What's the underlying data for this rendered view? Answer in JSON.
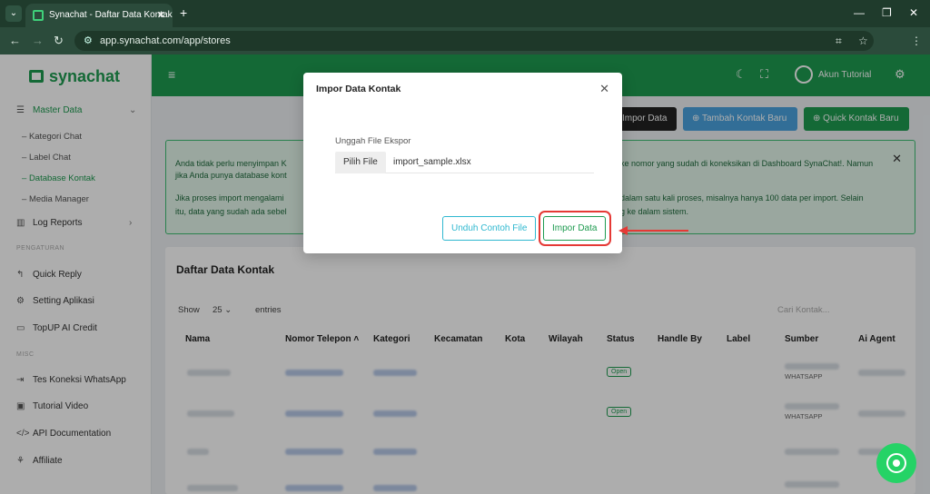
{
  "browser": {
    "tab_title": "Synachat - Daftar Data Kontak",
    "url": "app.synachat.com/app/stores"
  },
  "sidebar": {
    "brand": "synachat",
    "master_data": "Master Data",
    "sub_items": [
      "Kategori Chat",
      "Label Chat",
      "Database Kontak",
      "Media Manager"
    ],
    "log_reports": "Log Reports",
    "section_pengaturan": "PENGATURAN",
    "pengaturan_items": [
      "Quick Reply",
      "Setting Aplikasi",
      "TopUP AI Credit"
    ],
    "section_misc": "MISC",
    "misc_items": [
      "Tes Koneksi WhatsApp",
      "Tutorial Video",
      "API Documentation",
      "Affiliate"
    ]
  },
  "header": {
    "user_name": "Akun Tutorial"
  },
  "actions": {
    "impor": "Impor Data",
    "tambah": "Tambah Kontak Baru",
    "quick": "Quick Kontak Baru",
    "colors": {
      "impor": "#222222",
      "tambah": "#4aa3df",
      "quick": "#1e9b50"
    }
  },
  "alert": {
    "line1_a": "Anda tidak perlu menyimpan K",
    "line1_b": "ke nomor yang sudah di koneksikan di Dashboard SynaChat!. Namun",
    "line2_a": "jika Anda punya database kont",
    "line3_a": "Jika proses import mengalami",
    "line3_b": "dalam satu kali proses, misalnya hanya 100 data per import. Selain",
    "line4_a": "itu, data yang sudah ada sebel",
    "line4_b": "g ke dalam sistem."
  },
  "table": {
    "title": "Daftar Data Kontak",
    "show_label": "Show",
    "entries_value": "25",
    "entries_label": "entries",
    "search_placeholder": "Cari Kontak...",
    "headers": [
      "Nama",
      "Nomor Telepon",
      "Kategori",
      "Kecamatan",
      "Kota",
      "Wilayah",
      "Status",
      "Handle By",
      "Label",
      "Sumber",
      "Ai Agent"
    ],
    "status_label": "Open",
    "source_label": "WHATSAPP"
  },
  "modal": {
    "title": "Impor Data Kontak",
    "file_label": "Unggah File Ekspor",
    "pick_button": "Pilih File",
    "file_name": "import_sample.xlsx",
    "download_sample": "Unduh Contoh File",
    "import_button": "Impor Data"
  }
}
